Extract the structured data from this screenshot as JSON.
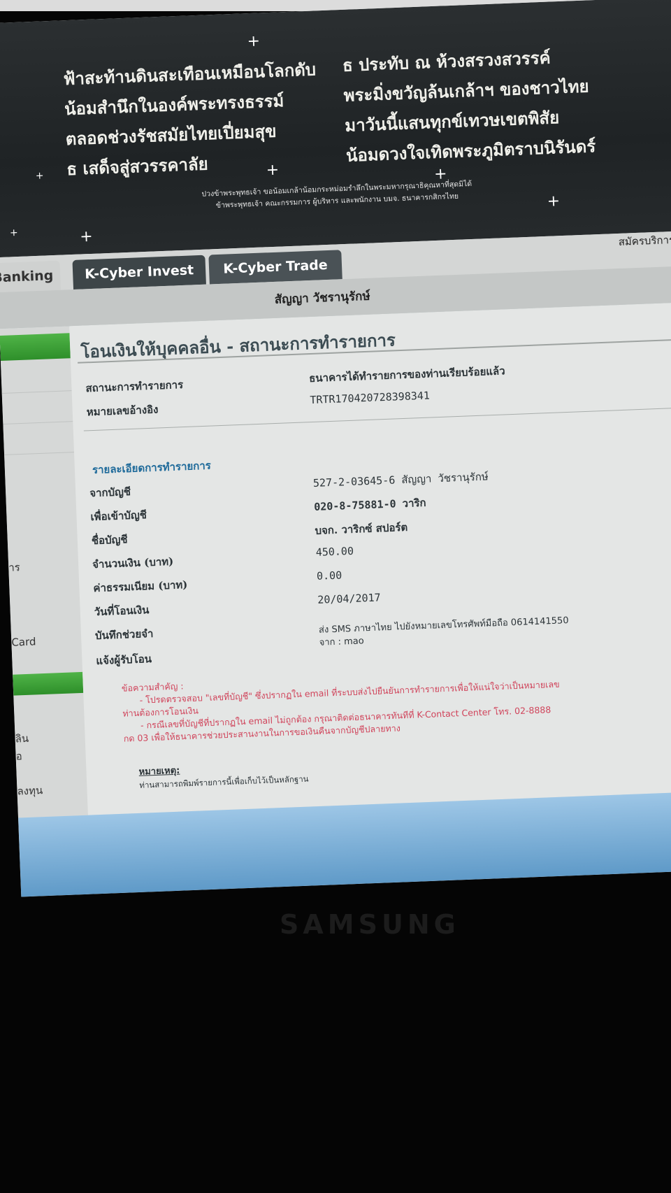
{
  "banner": {
    "poem_left": [
      "ฟ้าสะท้านดินสะเทือนเหมือนโลกดับ",
      "น้อมสำนึกในองค์พระทรงธรรม์",
      "ตลอดช่วงรัชสมัยไทยเปี่ยมสุข",
      "ธ เสด็จสู่สวรรคาลัย"
    ],
    "poem_right": [
      "ธ ประทับ ณ ห้วงสรวงสวรรค์",
      "พระมิ่งขวัญล้นเกล้าฯ ของชาวไทย",
      "มาวันนี้แสนทุกข์เทวษเขตพิสัย",
      "น้อมดวงใจเทิดพระภูมิตราบนิรันดร์"
    ],
    "caption_1": "ปวงข้าพระพุทธเจ้า ขอน้อมเกล้าน้อมกระหม่อมรำลึกในพระมหากรุณาธิคุณหาที่สุดมิได้",
    "caption_2": "ข้าพระพุทธเจ้า คณะกรรมการ ผู้บริหาร และพนักงาน บมจ. ธนาคารกสิกรไทย"
  },
  "nav": {
    "tab_banking": "Banking",
    "tab_invest": "K-Cyber Invest",
    "tab_trade": "K-Cyber Trade",
    "signup": "สมัครบริการ",
    "sep": "|"
  },
  "user": {
    "name": "สัญญา วัชรานุรักษ์"
  },
  "sidebar": {
    "item_1": "าร",
    "item_2": "Card",
    "item_3": "ลิน",
    "item_4": "อ",
    "item_5": "ลงทุน"
  },
  "page": {
    "title": "โอนเงินให้บุคคลอื่น - สถานะการทำรายการ",
    "status_label": "สถานะการทำรายการ",
    "status_value": "ธนาคารได้ทำรายการของท่านเรียบร้อยแล้ว",
    "ref_label": "หมายเลขอ้างอิง",
    "ref_value": "TRTR170420728398341",
    "section": "รายละเอียดการทำรายการ",
    "from_label": "จากบัญชี",
    "from_value": "527-2-03645-6 สัญญา วัชรานุรักษ์",
    "to_label": "เพื่อเข้าบัญชี",
    "to_value": "020-8-75881-0 วาริก",
    "name_label": "ชื่อบัญชี",
    "name_value": "บจก. วาริกซ์ สปอร์ต",
    "amount_label": "จำนวนเงิน (บาท)",
    "amount_value": "450.00",
    "fee_label": "ค่าธรรมเนียม (บาท)",
    "fee_value": "0.00",
    "date_label": "วันที่โอนเงิน",
    "date_value": "20/04/2017",
    "memo_label": "บันทึกช่วยจำ",
    "notify_label": "แจ้งผู้รับโอน",
    "notify_value_1": "ส่ง SMS ภาษาไทย ไปยังหมายเลขโทรศัพท์มือถือ 0614141550",
    "notify_value_2": "จาก : mao",
    "notice_head": "ข้อความสำคัญ :",
    "notice_1": "- โปรดตรวจสอบ \"เลขที่บัญชี\" ซึ่งปรากฏใน email ที่ระบบส่งไปยืนยันการทำรายการเพื่อให้แน่ใจว่าเป็นหมายเลข",
    "notice_2": "ท่านต้องการโอนเงิน",
    "notice_3": "- กรณีเลขที่บัญชีที่ปรากฏใน email ไม่ถูกต้อง กรุณาติดต่อธนาคารทันทีที่ K-Contact Center โทร. 02-8888",
    "notice_4": "กด 03 เพื่อให้ธนาคารช่วยประสานงานในการขอเงินคืนจากบัญชีปลายทาง",
    "remark_label": "หมายเหตุ:",
    "remark_text": "ท่านสามารถพิมพ์รายการนี้เพื่อเก็บไว้เป็นหลักฐาน"
  },
  "device": {
    "brand": "SAMSUNG"
  }
}
